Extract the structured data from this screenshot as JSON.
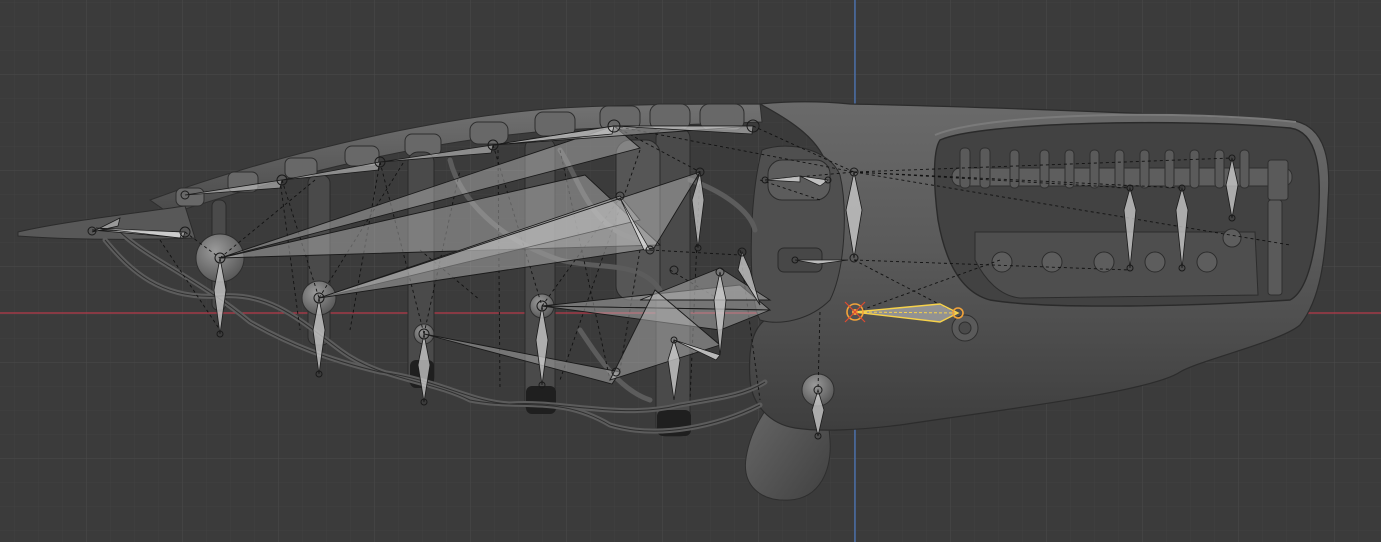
{
  "viewport": {
    "background": "#3b3b3b",
    "grid_minor_color": "#414141",
    "grid_major_color": "#4a4a4a",
    "x_axis_color": "#c0394a",
    "z_axis_color": "#4a78c0",
    "selection_color": "#f2a33a",
    "active_color": "#f7d24a",
    "bone_color": "#b8b8b8",
    "mesh_color": "#555555"
  },
  "armature": {
    "display": "octahedral",
    "selected_bone": "active-bone"
  }
}
